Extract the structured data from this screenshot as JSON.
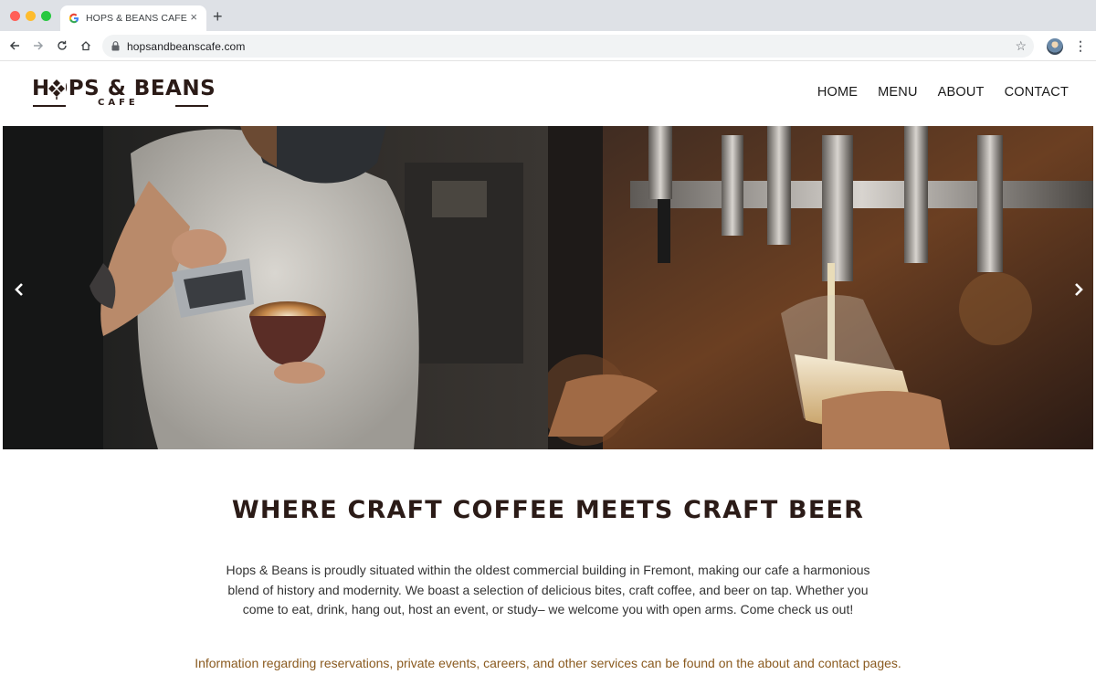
{
  "browser": {
    "tab_title": "HOPS & BEANS CAFE",
    "tab_close": "×",
    "new_tab": "+",
    "url": "hopsandbeanscafe.com",
    "menu_glyph": "⋮"
  },
  "site": {
    "logo_main": "HOPS & BEANS",
    "logo_sub": "CAFE",
    "nav": [
      "HOME",
      "MENU",
      "ABOUT",
      "CONTACT"
    ]
  },
  "hero": {
    "slides": [
      "barista-pouring-latte-art",
      "beer-tap-pouring-glass"
    ]
  },
  "content": {
    "headline": "WHERE CRAFT COFFEE MEETS CRAFT BEER",
    "intro": "Hops & Beans is proudly situated within the oldest commercial building in Fremont, making our cafe a harmonious blend of history and modernity. We boast a selection of delicious bites, craft coffee, and beer on tap. Whether you come to eat, drink, hang out, host an event, or study– we welcome you with open arms. Come check us out!",
    "notice": "Information regarding reservations, private events, careers, and other services can be found on the about and contact pages."
  },
  "colors": {
    "brand_dark": "#2b1b17",
    "notice": "#8a5a1f"
  }
}
